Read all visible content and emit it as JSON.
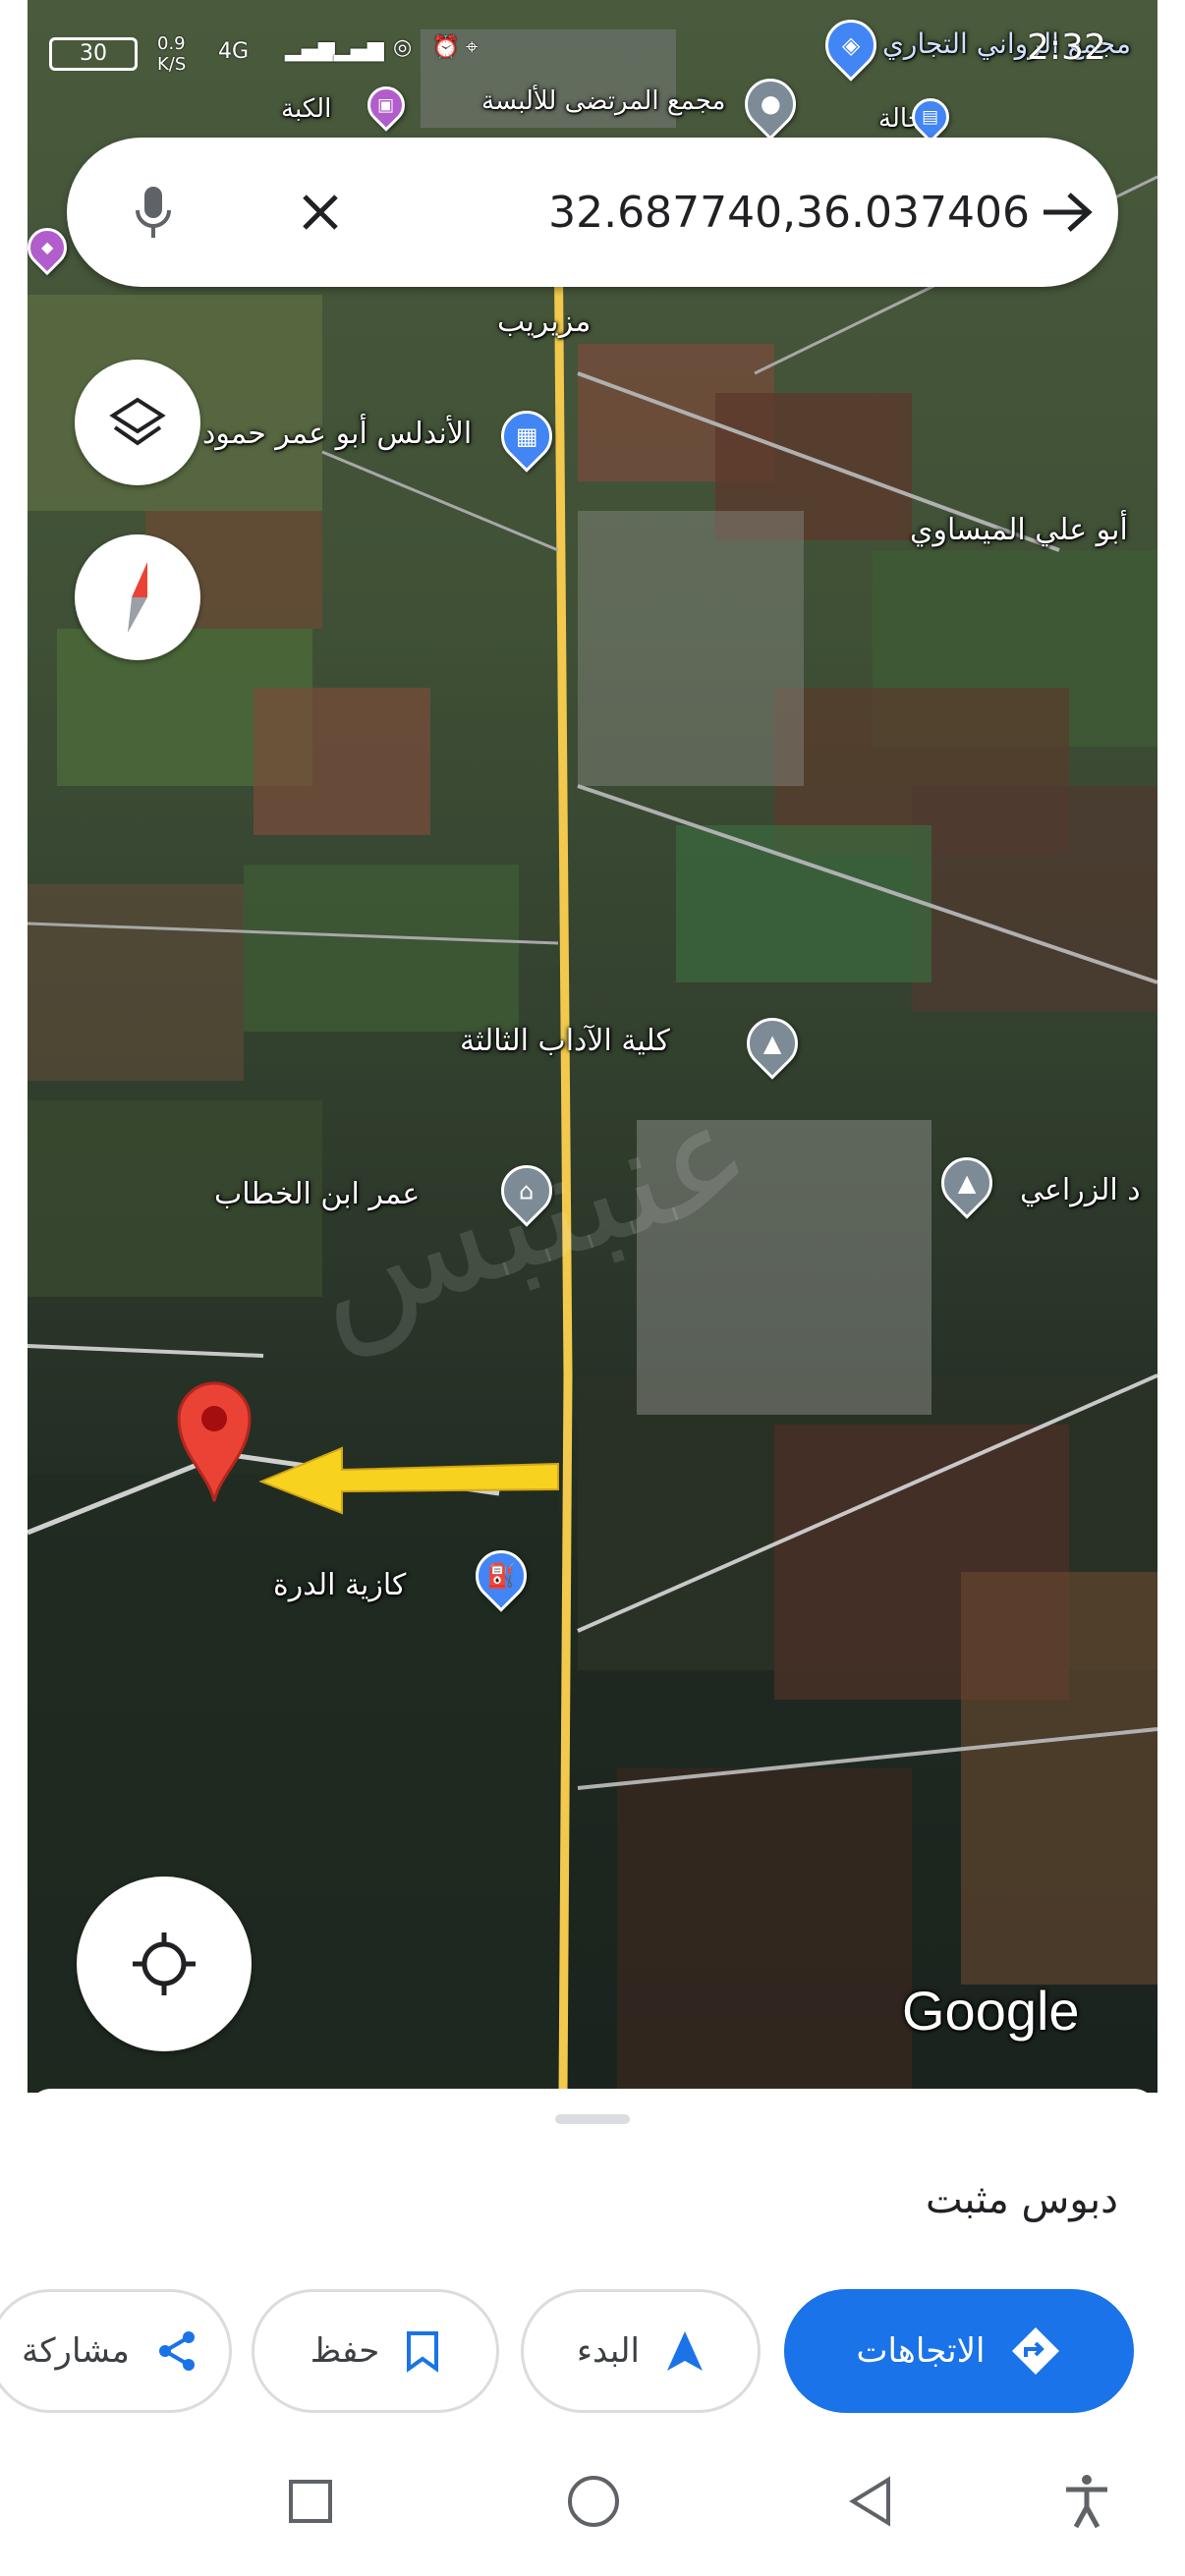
{
  "status_bar": {
    "battery": "30",
    "network_speed": "0.9 K/S",
    "network_type": "4G",
    "time": "2:32"
  },
  "search": {
    "query": "32.687740,36.037406"
  },
  "map": {
    "labels": {
      "top_blue_1": "مجمع الرواني التجاري",
      "top_white_1": "مجمع المرتضى للألبسة",
      "top_white_2": "الكبة",
      "top_white_3": "الخالة",
      "town": "مزيريب",
      "andalus": "الأندلس أبو عمر حمود",
      "abu_ali": "أبو علي الميساوي",
      "college": "كلية الآداب الثالثة",
      "agri": "د الزراعي",
      "omar": "عمر ابن الخطاب",
      "gas": "كازية الدرة"
    },
    "attribution": "Google",
    "watermark": "عنبتبس",
    "pin_color": "#ea4335",
    "arrow_color": "#f7d320",
    "road_color": "#f2c94c"
  },
  "icons": {
    "mic": "mic-icon",
    "clear": "close-icon",
    "go": "arrow-forward-icon",
    "layers": "layers-icon",
    "compass": "compass-icon",
    "location": "my-location-icon"
  },
  "sheet": {
    "title": "دبوس مثبت",
    "actions": {
      "directions": "الاتجاهات",
      "start": "البدء",
      "save": "حفظ",
      "share": "مشاركة"
    }
  },
  "colors": {
    "accent": "#1a73e8"
  }
}
